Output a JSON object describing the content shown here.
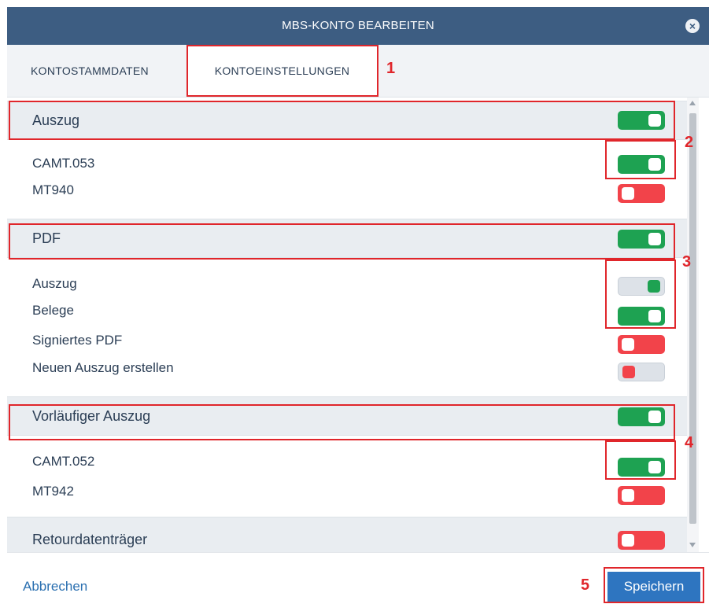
{
  "dialog": {
    "title": "MBS-KONTO BEARBEITEN",
    "close_icon": "close-icon"
  },
  "tabs": {
    "account_master": "KONTOSTAMMDATEN",
    "account_settings": "KONTOEINSTELLUNGEN",
    "active": "KONTOEINSTELLUNGEN"
  },
  "sections": {
    "statement": {
      "label": "Auszug",
      "enabled": true
    },
    "camt053": {
      "label": "CAMT.053",
      "enabled": true
    },
    "mt940": {
      "label": "MT940",
      "enabled": false
    },
    "pdf": {
      "label": "PDF",
      "enabled": true
    },
    "pdf_statement": {
      "label": "Auszug",
      "enabled": true,
      "locked": true
    },
    "pdf_receipts": {
      "label": "Belege",
      "enabled": true
    },
    "signed_pdf": {
      "label": "Signiertes PDF",
      "enabled": false
    },
    "new_statement": {
      "label": "Neuen Auszug erstellen",
      "enabled": false,
      "locked": true
    },
    "preliminary": {
      "label": "Vorläufiger Auszug",
      "enabled": true
    },
    "camt052": {
      "label": "CAMT.052",
      "enabled": true
    },
    "mt942": {
      "label": "MT942",
      "enabled": false
    },
    "return_media": {
      "label": "Retourdatenträger",
      "enabled": false
    }
  },
  "footer": {
    "cancel_label": "Abbrechen",
    "save_label": "Speichern"
  },
  "annotations": [
    "1",
    "2",
    "3",
    "4",
    "5"
  ],
  "colors": {
    "header_bg": "#3d5d82",
    "toggle_on": "#1ea252",
    "toggle_off": "#f2434a",
    "primary_button": "#2e75c0",
    "link": "#2a6fb0",
    "annotation": "#e0262b"
  }
}
